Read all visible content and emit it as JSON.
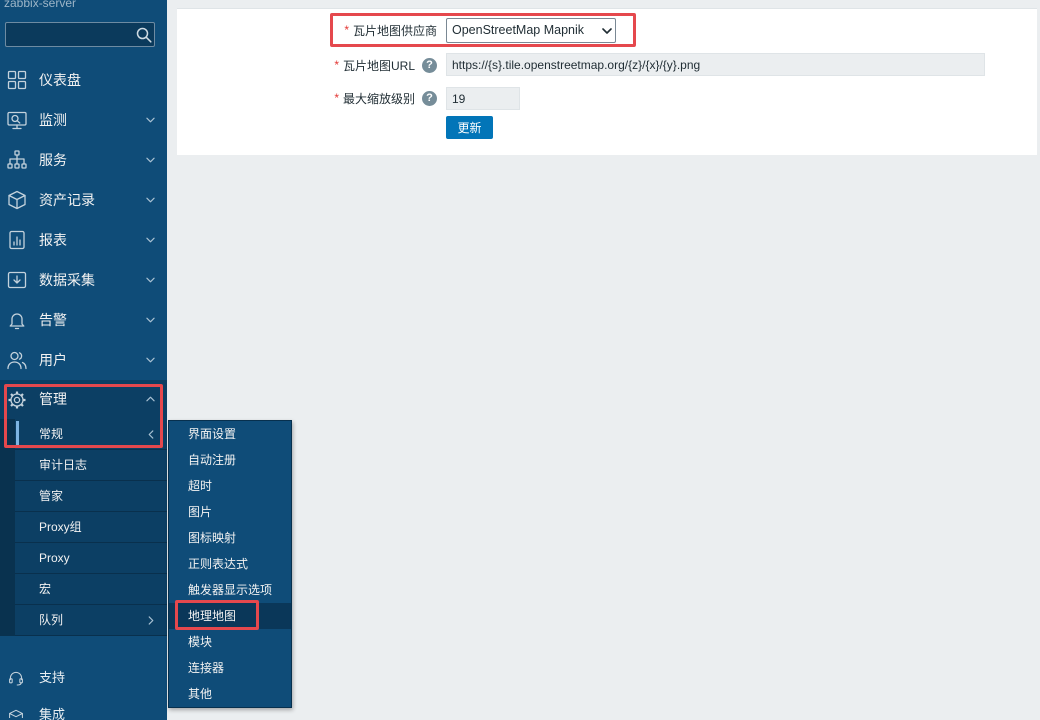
{
  "sidebar": {
    "server_name": "zabbix-server",
    "menu": [
      {
        "label": "仪表盘",
        "icon": "dashboard-icon"
      },
      {
        "label": "监测",
        "icon": "monitoring-icon",
        "expandable": true
      },
      {
        "label": "服务",
        "icon": "services-icon",
        "expandable": true
      },
      {
        "label": "资产记录",
        "icon": "inventory-icon",
        "expandable": true
      },
      {
        "label": "报表",
        "icon": "reports-icon",
        "expandable": true
      },
      {
        "label": "数据采集",
        "icon": "data-collection-icon",
        "expandable": true
      },
      {
        "label": "告警",
        "icon": "alerts-icon",
        "expandable": true
      },
      {
        "label": "用户",
        "icon": "users-icon",
        "expandable": true
      },
      {
        "label": "管理",
        "icon": "administration-icon",
        "expanded": true
      }
    ],
    "submenu": [
      {
        "label": "常规",
        "active": true,
        "has_flyout": true
      },
      {
        "label": "审计日志"
      },
      {
        "label": "管家"
      },
      {
        "label": "Proxy组"
      },
      {
        "label": "Proxy"
      },
      {
        "label": "宏"
      },
      {
        "label": "队列",
        "has_children": true
      }
    ],
    "bottom": [
      {
        "label": "支持",
        "icon": "support-icon"
      },
      {
        "label": "集成",
        "icon": "integrations-icon"
      }
    ]
  },
  "flyout": {
    "items": [
      {
        "label": "界面设置"
      },
      {
        "label": "自动注册"
      },
      {
        "label": "超时"
      },
      {
        "label": "图片"
      },
      {
        "label": "图标映射"
      },
      {
        "label": "正则表达式"
      },
      {
        "label": "触发器显示选项"
      },
      {
        "label": "地理地图",
        "active": true
      },
      {
        "label": "模块"
      },
      {
        "label": "连接器"
      },
      {
        "label": "其他"
      }
    ]
  },
  "form": {
    "required_mark": "*",
    "help_mark": "?",
    "tile_provider": {
      "label": "瓦片地图供应商",
      "value": "OpenStreetMap Mapnik"
    },
    "tile_url": {
      "label": "瓦片地图URL",
      "value": "https://{s}.tile.openstreetmap.org/{z}/{x}/{y}.png"
    },
    "max_zoom": {
      "label": "最大缩放级别",
      "value": "19"
    },
    "update_button": "更新"
  },
  "colors": {
    "sidebar_bg": "#0f4c78",
    "submenu_bg": "#0c3f64",
    "highlight_border": "#e5484d",
    "primary_button": "#0275b8",
    "required_mark": "#e33734",
    "help_icon": "#768d99"
  }
}
